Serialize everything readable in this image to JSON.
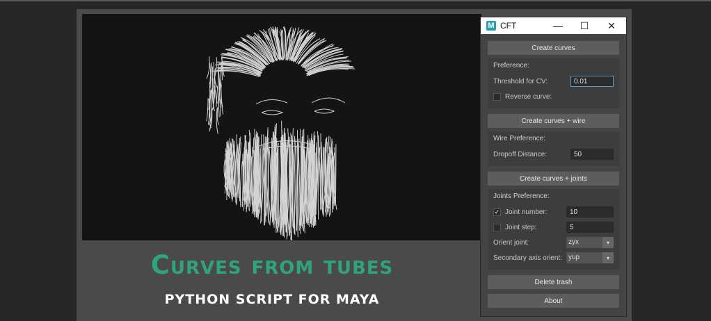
{
  "banner": {
    "title": "Curves from tubes",
    "subtitle": "PYTHON SCRIPT FOR MAYA"
  },
  "window": {
    "title": "CFT",
    "logo_letter": "M",
    "controls": {
      "minimize": "—",
      "maximize": "☐",
      "close": "✕"
    }
  },
  "buttons": {
    "create_curves": "Create curves",
    "create_curves_wire": "Create curves + wire",
    "create_curves_joints": "Create curves + joints",
    "delete_trash": "Delete trash",
    "about": "About"
  },
  "preference": {
    "label": "Preference:",
    "threshold_label": "Threshold for CV:",
    "threshold_value": "0.01",
    "reverse_label": "Reverse curve:",
    "reverse_checked": false
  },
  "wire": {
    "label": "Wire Preference:",
    "dropoff_label": "Dropoff Distance:",
    "dropoff_value": "50"
  },
  "joints": {
    "label": "Joints Preference:",
    "joint_number_label": "Joint number:",
    "joint_number_checked": true,
    "joint_number_value": "10",
    "joint_step_label": "Joint step:",
    "joint_step_checked": false,
    "joint_step_value": "5",
    "orient_label": "Orient joint:",
    "orient_value": "zyx",
    "secondary_label": "Secondary axis orient:",
    "secondary_value": "yup"
  },
  "colors": {
    "accent_green": "#2fa37e",
    "viewport_bg": "#141414",
    "panel_bg": "#444444"
  },
  "icons": {
    "dropdown": "▾",
    "check": "✓"
  }
}
